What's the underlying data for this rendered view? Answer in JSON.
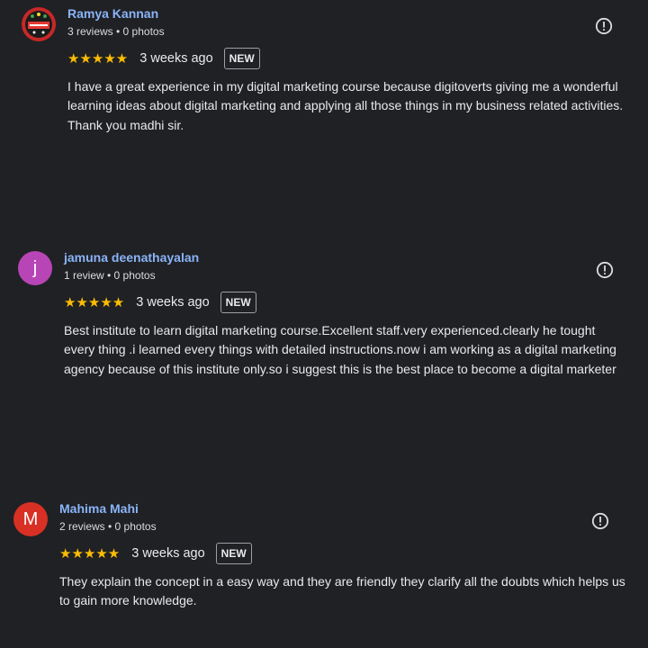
{
  "reviews": [
    {
      "author": "Ramya Kannan",
      "meta": "3 reviews • 0 photos",
      "stars": "★★★★★",
      "rating": 5,
      "time": "3 weeks ago",
      "badge": "NEW",
      "avatar_letter": "",
      "avatar_color": "#b71c1c",
      "text_lines": [
        "I have a great experience in my digital marketing course because digitoverts giving me a wonderful learning ideas about digital marketing and applying all those things in my business related activities.",
        "Thank you madhi sir."
      ]
    },
    {
      "author": "jamuna deenathayalan",
      "meta": "1 review • 0 photos",
      "stars": "★★★★★",
      "rating": 5,
      "time": "3 weeks ago",
      "badge": "NEW",
      "avatar_letter": "j",
      "avatar_color": "#b845b6",
      "text_lines": [
        "Best institute to learn digital marketing course.Excellent staff.very experienced.clearly he tought every thing .i learned every things with detailed instructions.now i am working as a digital marketing agency because of this institute only.so i suggest this is the best place to become a digital marketer"
      ]
    },
    {
      "author": "Mahima Mahi",
      "meta": "2 reviews • 0 photos",
      "stars": "★★★★★",
      "rating": 5,
      "time": "3 weeks ago",
      "badge": "NEW",
      "avatar_letter": "M",
      "avatar_color": "#d93025",
      "text_lines": [
        "They explain the concept in a easy way and they are friendly they clarify all the doubts which helps us to gain more knowledge."
      ]
    }
  ],
  "colors": {
    "background": "#202124",
    "author": "#8ab4f8",
    "star": "#fbbc04",
    "text": "#e8eaed"
  },
  "icons": {
    "report": "exclamation-circle-icon",
    "star": "star-icon"
  }
}
